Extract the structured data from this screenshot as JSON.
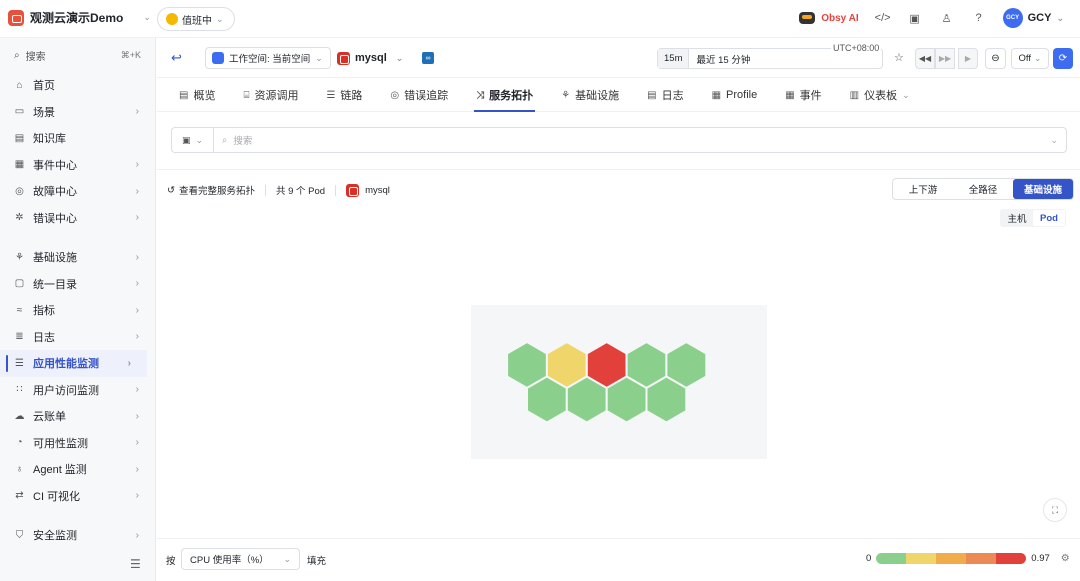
{
  "workspace": {
    "name": "观测云演示Demo",
    "chevron": "⌄"
  },
  "duty": {
    "label": "值班中"
  },
  "topbar": {
    "obsy": "Obsy AI",
    "user": "GCY",
    "avatar": "GCY"
  },
  "sidebar": {
    "search_label": "搜索",
    "search_shortcut": "⌘+K",
    "items": [
      {
        "label": "首页",
        "icon": "home-icon",
        "arrow": false
      },
      {
        "label": "场景",
        "icon": "scene-icon",
        "arrow": true
      },
      {
        "label": "知识库",
        "icon": "book-icon",
        "arrow": false
      },
      {
        "label": "事件中心",
        "icon": "calendar-icon",
        "arrow": true
      },
      {
        "label": "故障中心",
        "icon": "fault-icon",
        "arrow": true
      },
      {
        "label": "错误中心",
        "icon": "bug-icon",
        "arrow": true
      },
      {
        "label": "基础设施",
        "icon": "infra-icon",
        "arrow": true
      },
      {
        "label": "统一目录",
        "icon": "catalog-icon",
        "arrow": true
      },
      {
        "label": "指标",
        "icon": "metric-icon",
        "arrow": true
      },
      {
        "label": "日志",
        "icon": "log-icon",
        "arrow": true
      },
      {
        "label": "应用性能监测",
        "icon": "apm-icon",
        "arrow": true,
        "active": true
      },
      {
        "label": "用户访问监测",
        "icon": "rum-icon",
        "arrow": true
      },
      {
        "label": "云账单",
        "icon": "cloud-icon",
        "arrow": true
      },
      {
        "label": "可用性监测",
        "icon": "dial-icon",
        "arrow": true
      },
      {
        "label": "Agent 监测",
        "icon": "agent-icon",
        "arrow": true
      },
      {
        "label": "CI 可视化",
        "icon": "ci-icon",
        "arrow": true
      },
      {
        "label": "安全监测",
        "icon": "shield-icon",
        "arrow": true
      }
    ]
  },
  "toolbar": {
    "workspace_select": "工作空间: 当前空间",
    "service": "mysql",
    "time_short": "15m",
    "time_range": "最近 15 分钟",
    "timezone": "UTC+08:00",
    "refresh_mode": "Off"
  },
  "tabs": [
    {
      "label": "概览",
      "icon": "overview-icon"
    },
    {
      "label": "资源调用",
      "icon": "resource-icon"
    },
    {
      "label": "链路",
      "icon": "trace-icon"
    },
    {
      "label": "错误追踪",
      "icon": "error-icon"
    },
    {
      "label": "服务拓扑",
      "icon": "topology-icon",
      "active": true
    },
    {
      "label": "基础设施",
      "icon": "infra-icon"
    },
    {
      "label": "日志",
      "icon": "log-icon"
    },
    {
      "label": "Profile",
      "icon": "profile-icon"
    },
    {
      "label": "事件",
      "icon": "event-icon"
    },
    {
      "label": "仪表板",
      "icon": "dashboard-icon",
      "dropdown": true
    }
  ],
  "filter": {
    "placeholder": "搜索"
  },
  "info": {
    "full_topology": "查看完整服务拓扑",
    "pod_count": "共 9 个 Pod",
    "service": "mysql"
  },
  "view_modes": [
    "上下游",
    "全路径",
    "基础设施"
  ],
  "view_active": "基础设施",
  "object_modes": [
    "主机",
    "Pod"
  ],
  "object_active": "Pod",
  "honeycomb": {
    "rows": [
      [
        "#8bcf8c",
        "#f0d56a",
        "#e2403a",
        "#8bcf8c",
        "#8bcf8c"
      ],
      [
        "#8bcf8c",
        "#8bcf8c",
        "#8bcf8c",
        "#8bcf8c"
      ]
    ]
  },
  "bottom": {
    "by_label": "按",
    "metric": "CPU 使用率（%）",
    "fill_label": "填充",
    "min": "0",
    "max": "0.97",
    "legend_colors": [
      "#8bcf8c",
      "#f0d56a",
      "#f0ac4a",
      "#ec8a55",
      "#e2403a"
    ]
  }
}
